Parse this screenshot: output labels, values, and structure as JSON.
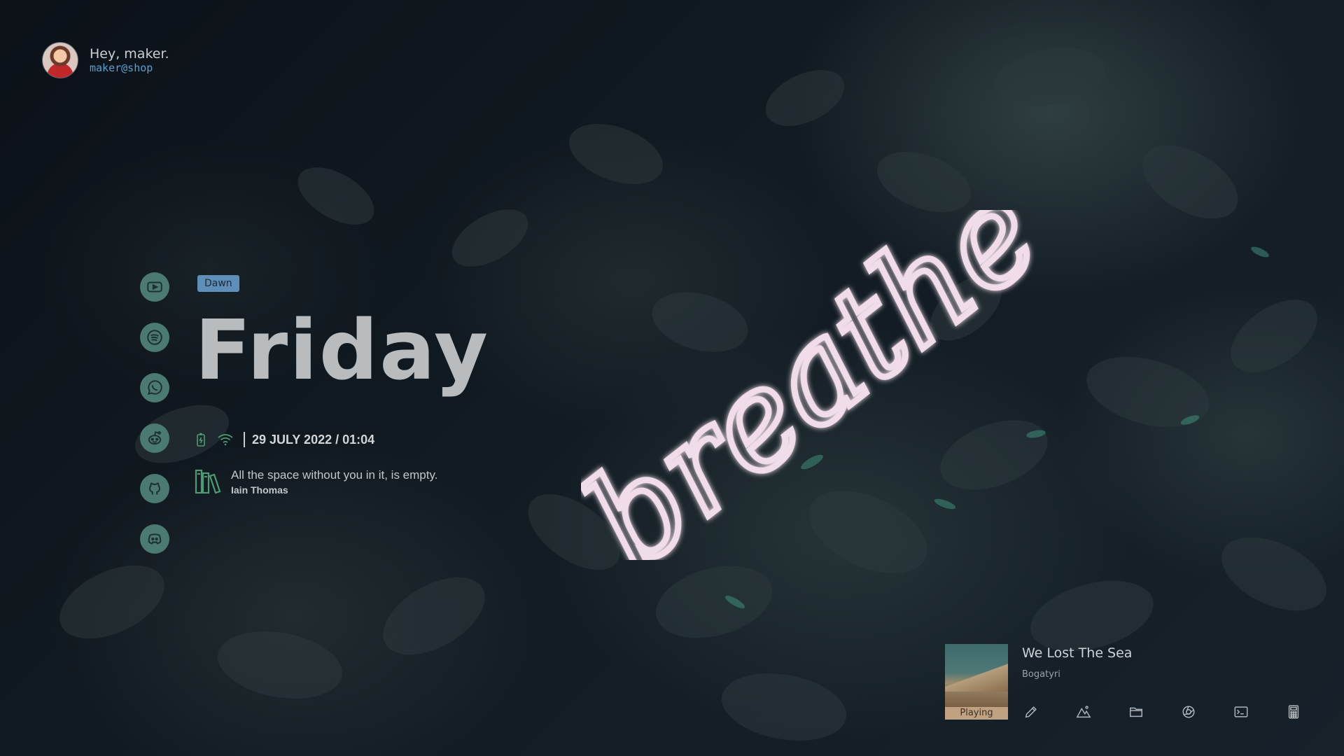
{
  "greeting": {
    "title": "Hey, maker.",
    "user": "maker@shop"
  },
  "launcher": {
    "apps": [
      {
        "icon": "youtube-icon"
      },
      {
        "icon": "spotify-icon"
      },
      {
        "icon": "whatsapp-icon"
      },
      {
        "icon": "reddit-icon"
      },
      {
        "icon": "github-icon"
      },
      {
        "icon": "discord-icon"
      }
    ]
  },
  "main": {
    "time_of_day": "Dawn",
    "day": "Friday",
    "datetime": "29 JULY 2022 / 01:04",
    "quote": {
      "text": "All the space without you in it, is empty.",
      "author": "Iain Thomas"
    }
  },
  "wallpaper": {
    "neon_text": "breathe"
  },
  "music": {
    "title": "We Lost The Sea",
    "artist": "Bogatyri",
    "status": "Playing"
  },
  "dock": {
    "items": [
      {
        "icon": "pencil-icon"
      },
      {
        "icon": "mountain-image-icon"
      },
      {
        "icon": "folder-icon"
      },
      {
        "icon": "browser-icon"
      },
      {
        "icon": "terminal-icon"
      },
      {
        "icon": "calculator-icon"
      }
    ]
  },
  "colors": {
    "accent_teal": "#4a7a72",
    "chip_blue": "#5f8fb8",
    "user_blue": "#5c9fcc",
    "playing_tan": "#c0a283",
    "background": "#0e141b"
  }
}
